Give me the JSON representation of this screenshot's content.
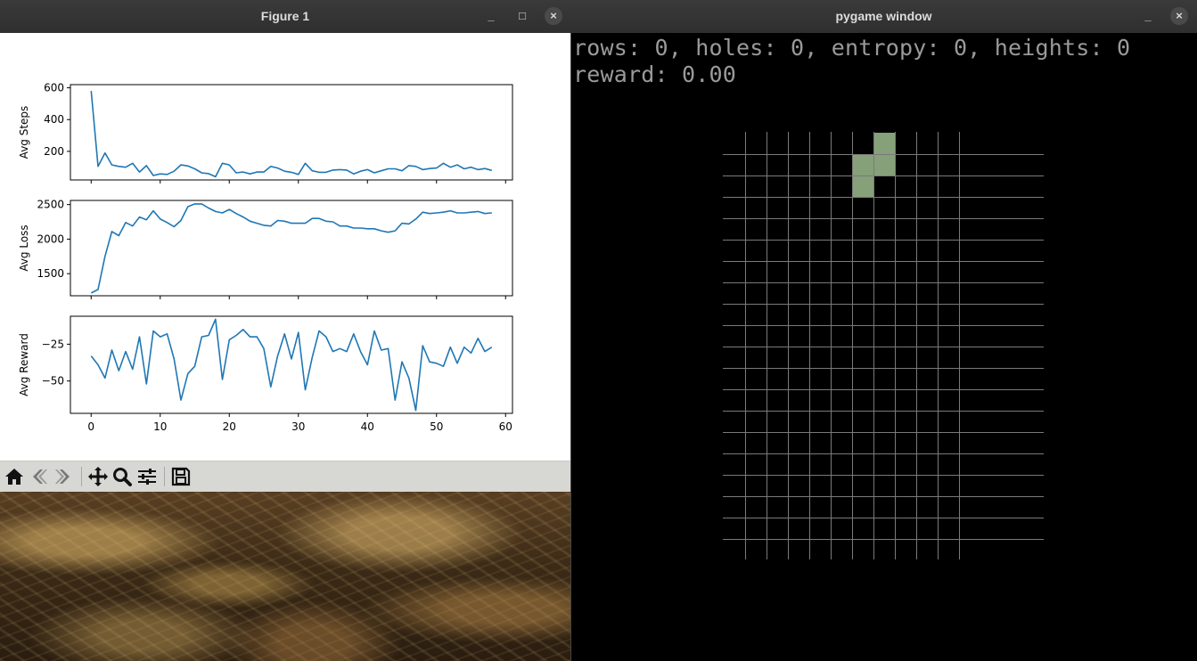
{
  "figure_window": {
    "title": "Figure 1",
    "controls": {
      "minimize": "_",
      "maximize": "□",
      "close": "×"
    }
  },
  "chart_data": [
    {
      "type": "line",
      "ylabel": "Avg Steps",
      "xlim": [
        -3,
        61
      ],
      "ylim": [
        20,
        620
      ],
      "yticks": [
        200,
        400,
        600
      ],
      "ytick_labels": [
        "200",
        "400",
        "600"
      ],
      "show_xtick_labels": false,
      "color": "#1f77b4",
      "x": [
        0,
        1,
        2,
        3,
        4,
        5,
        6,
        7,
        8,
        9,
        10,
        11,
        12,
        13,
        14,
        15,
        16,
        17,
        18,
        19,
        20,
        21,
        22,
        23,
        24,
        25,
        26,
        27,
        28,
        29,
        30,
        31,
        32,
        33,
        34,
        35,
        36,
        37,
        38,
        39,
        40,
        41,
        42,
        43,
        44,
        45,
        46,
        47,
        48,
        49,
        50,
        51,
        52,
        53,
        54,
        55,
        56,
        57,
        58
      ],
      "y": [
        580,
        105,
        190,
        115,
        105,
        100,
        125,
        70,
        110,
        48,
        58,
        55,
        75,
        115,
        108,
        90,
        65,
        60,
        40,
        125,
        115,
        65,
        70,
        58,
        70,
        70,
        105,
        95,
        75,
        68,
        55,
        125,
        78,
        68,
        68,
        82,
        85,
        82,
        58,
        75,
        85,
        65,
        78,
        90,
        90,
        78,
        110,
        105,
        85,
        92,
        95,
        125,
        100,
        115,
        90,
        100,
        85,
        92,
        80
      ]
    },
    {
      "type": "line",
      "ylabel": "Avg Loss",
      "xlim": [
        -3,
        61
      ],
      "ylim": [
        1180,
        2560
      ],
      "yticks": [
        1500,
        2000,
        2500
      ],
      "ytick_labels": [
        "1500",
        "2000",
        "2500"
      ],
      "show_xtick_labels": false,
      "color": "#1f77b4",
      "x": [
        0,
        1,
        2,
        3,
        4,
        5,
        6,
        7,
        8,
        9,
        10,
        11,
        12,
        13,
        14,
        15,
        16,
        17,
        18,
        19,
        20,
        21,
        22,
        23,
        24,
        25,
        26,
        27,
        28,
        29,
        30,
        31,
        32,
        33,
        34,
        35,
        36,
        37,
        38,
        39,
        40,
        41,
        42,
        43,
        44,
        45,
        46,
        47,
        48,
        49,
        50,
        51,
        52,
        53,
        54,
        55,
        56,
        57,
        58
      ],
      "y": [
        1220,
        1270,
        1750,
        2110,
        2050,
        2240,
        2190,
        2320,
        2280,
        2410,
        2290,
        2240,
        2180,
        2270,
        2470,
        2510,
        2510,
        2450,
        2400,
        2380,
        2430,
        2370,
        2320,
        2260,
        2230,
        2200,
        2190,
        2270,
        2260,
        2230,
        2230,
        2230,
        2300,
        2300,
        2260,
        2250,
        2190,
        2190,
        2160,
        2160,
        2150,
        2150,
        2120,
        2100,
        2120,
        2230,
        2220,
        2290,
        2390,
        2370,
        2380,
        2390,
        2410,
        2380,
        2380,
        2390,
        2400,
        2370,
        2380
      ]
    },
    {
      "type": "line",
      "ylabel": "Avg Reward",
      "xlabel": "",
      "xlim": [
        -3,
        61
      ],
      "ylim": [
        -72,
        -6
      ],
      "yticks": [
        -50,
        -25
      ],
      "ytick_labels": [
        "−50",
        "−25"
      ],
      "xticks": [
        0,
        10,
        20,
        30,
        40,
        50,
        60
      ],
      "xtick_labels": [
        "0",
        "10",
        "20",
        "30",
        "40",
        "50",
        "60"
      ],
      "show_xtick_labels": true,
      "color": "#1f77b4",
      "x": [
        0,
        1,
        2,
        3,
        4,
        5,
        6,
        7,
        8,
        9,
        10,
        11,
        12,
        13,
        14,
        15,
        16,
        17,
        18,
        19,
        20,
        21,
        22,
        23,
        24,
        25,
        26,
        27,
        28,
        29,
        30,
        31,
        32,
        33,
        34,
        35,
        36,
        37,
        38,
        39,
        40,
        41,
        42,
        43,
        44,
        45,
        46,
        47,
        48,
        49,
        50,
        51,
        52,
        53,
        54,
        55,
        56,
        57,
        58
      ],
      "y": [
        -33,
        -39,
        -48,
        -29,
        -43,
        -30,
        -42,
        -20,
        -52,
        -16,
        -20,
        -18,
        -35,
        -63,
        -45,
        -40,
        -20,
        -19,
        -8,
        -49,
        -22,
        -19,
        -15,
        -20,
        -20,
        -28,
        -54,
        -33,
        -18,
        -35,
        -17,
        -56,
        -34,
        -16,
        -20,
        -30,
        -28,
        -30,
        -18,
        -30,
        -39,
        -16,
        -29,
        -28,
        -63,
        -37,
        -48,
        -70,
        -26,
        -37,
        -38,
        -40,
        -27,
        -38,
        -27,
        -31,
        -21,
        -30,
        -27
      ]
    }
  ],
  "toolbar": {
    "buttons": [
      {
        "name": "home-icon"
      },
      {
        "name": "back-icon"
      },
      {
        "name": "forward-icon"
      },
      {
        "name": "pan-icon"
      },
      {
        "name": "zoom-icon"
      },
      {
        "name": "configure-subplots-icon"
      },
      {
        "name": "save-icon"
      }
    ]
  },
  "pygame_window": {
    "title": "pygame window",
    "controls": {
      "minimize": "_",
      "close": "×"
    },
    "hud_line1": "rows: 0, holes: 0, entropy: 0, heights: 0",
    "hud_line2": "reward: 0.00",
    "board": {
      "columns": 10,
      "rows": 20,
      "grid_color": "#7a7a7a",
      "block_color": "#86a07a",
      "filled_cells": [
        [
          0,
          6
        ],
        [
          1,
          5
        ],
        [
          1,
          6
        ],
        [
          2,
          5
        ]
      ]
    }
  }
}
